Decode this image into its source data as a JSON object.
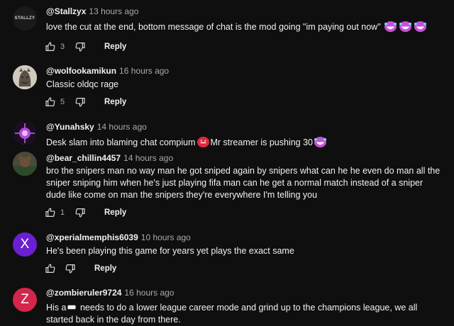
{
  "comments": [
    {
      "author": "@Stallzyx",
      "time": "13 hours ago",
      "text": "love the cut at the end, bottom message of chat is the mod going \"im paying out now\"",
      "likes": "3",
      "reply_label": "Reply",
      "avatar_text": "STALLZY"
    },
    {
      "author": "@wolfookamikun",
      "time": "16 hours ago",
      "text": "Classic oldqc rage",
      "likes": "5",
      "reply_label": "Reply"
    },
    {
      "author": "@Yunahsky",
      "time": "14 hours ago",
      "text_a": "Desk slam into blaming chat compium",
      "text_b": "Mr streamer is pushing 30"
    },
    {
      "author": "@bear_chillin4457",
      "time": "14 hours ago",
      "text": "bro the snipers man no way man he got sniped again by snipers what can he he even do man all the sniper sniping him when he's just playing fifa man can he get a normal match instead of a sniper dude like come on man the snipers they're everywhere I'm telling you",
      "likes": "1",
      "reply_label": "Reply"
    },
    {
      "author": "@xperialmemphis6039",
      "time": "10 hours ago",
      "text": "He's been playing this game for years yet plays the exact same",
      "reply_label": "Reply",
      "avatar_letter": "X",
      "avatar_color": "#6a1fd1"
    },
    {
      "author": "@zombieruler9724",
      "time": "16 hours ago",
      "text_a": "His a",
      "text_b": " needs to do a lower league career mode and grind up to the champions league, we all started back in the day from there.",
      "avatar_letter": "Z",
      "avatar_color": "#d4254b"
    }
  ]
}
